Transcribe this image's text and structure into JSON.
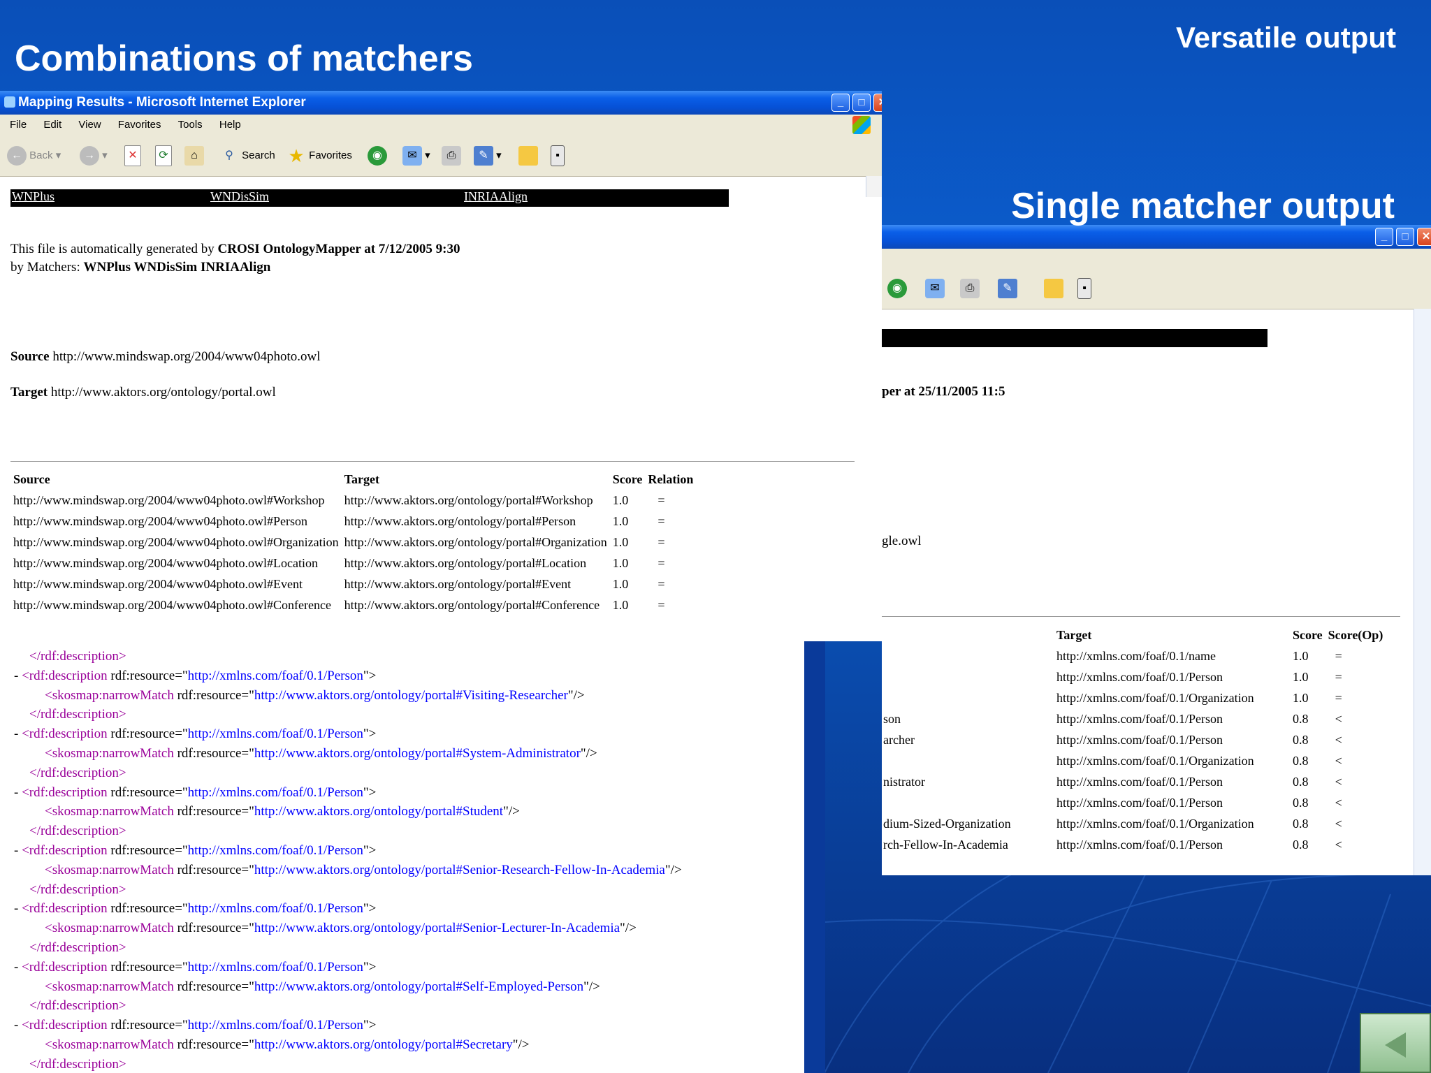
{
  "slide": {
    "title_left": "Combinations of matchers",
    "title_right": "Versatile output",
    "title_single": "Single matcher output"
  },
  "ie_window": {
    "title": "Mapping Results - Microsoft Internet Explorer",
    "menu": [
      "File",
      "Edit",
      "View",
      "Favorites",
      "Tools",
      "Help"
    ],
    "toolbar": {
      "back": "Back",
      "search": "Search",
      "favorites": "Favorites"
    },
    "nav_links": [
      "WNPlus",
      "WNDisSim",
      "INRIAAlign"
    ],
    "generated_prefix": "This file is automatically generated by ",
    "generated_bold": "CROSI OntologyMapper at 7/12/2005 9:30",
    "matchers_prefix": "by Matchers: ",
    "matchers_bold": "WNPlus WNDisSim INRIAAlign",
    "source_label": "Source",
    "source_url": "http://www.mindswap.org/2004/www04photo.owl",
    "target_label": "Target",
    "target_url": "http://www.aktors.org/ontology/portal.owl",
    "table": {
      "headers": [
        "Source",
        "Target",
        "Score",
        "Relation"
      ],
      "rows": [
        [
          "http://www.mindswap.org/2004/www04photo.owl#Workshop",
          "http://www.aktors.org/ontology/portal#Workshop",
          "1.0",
          "="
        ],
        [
          "http://www.mindswap.org/2004/www04photo.owl#Person",
          "http://www.aktors.org/ontology/portal#Person",
          "1.0",
          "="
        ],
        [
          "http://www.mindswap.org/2004/www04photo.owl#Organization",
          "http://www.aktors.org/ontology/portal#Organization",
          "1.0",
          "="
        ],
        [
          "http://www.mindswap.org/2004/www04photo.owl#Location",
          "http://www.aktors.org/ontology/portal#Location",
          "1.0",
          "="
        ],
        [
          "http://www.mindswap.org/2004/www04photo.owl#Event",
          "http://www.aktors.org/ontology/portal#Event",
          "1.0",
          "="
        ],
        [
          "http://www.mindswap.org/2004/www04photo.owl#Conference",
          "http://www.aktors.org/ontology/portal#Conference",
          "1.0",
          "="
        ]
      ]
    }
  },
  "single_window": {
    "generated_fragment": "per at 25/11/2005 11:5",
    "owl_fragment": "gle.owl",
    "table": {
      "headers": [
        "Target",
        "Score",
        "Score(Op)"
      ],
      "rows": [
        [
          "",
          "http://xmlns.com/foaf/0.1/name",
          "1.0",
          "="
        ],
        [
          "",
          "http://xmlns.com/foaf/0.1/Person",
          "1.0",
          "="
        ],
        [
          "",
          "http://xmlns.com/foaf/0.1/Organization",
          "1.0",
          "="
        ],
        [
          "son",
          "http://xmlns.com/foaf/0.1/Person",
          "0.8",
          "<"
        ],
        [
          "archer",
          "http://xmlns.com/foaf/0.1/Person",
          "0.8",
          "<"
        ],
        [
          "",
          "http://xmlns.com/foaf/0.1/Organization",
          "0.8",
          "<"
        ],
        [
          "nistrator",
          "http://xmlns.com/foaf/0.1/Person",
          "0.8",
          "<"
        ],
        [
          "",
          "http://xmlns.com/foaf/0.1/Person",
          "0.8",
          "<"
        ],
        [
          "dium-Sized-Organization",
          "http://xmlns.com/foaf/0.1/Organization",
          "0.8",
          "<"
        ],
        [
          "rch-Fellow-In-Academia",
          "http://xmlns.com/foaf/0.1/Person",
          "0.8",
          "<"
        ]
      ]
    }
  },
  "xml_view": {
    "close_tag": "</rdf:description>",
    "dash": "-",
    "desc_open": "<rdf:description",
    "attr_name": "rdf:resource",
    "person_value": "http://xmlns.com/foaf/0.1/Person",
    "narrow_open": "<skosmap:narrowMatch",
    "narrow_values": [
      "http://www.aktors.org/ontology/portal#Visiting-Researcher",
      "http://www.aktors.org/ontology/portal#System-Administrator",
      "http://www.aktors.org/ontology/portal#Student",
      "http://www.aktors.org/ontology/portal#Senior-Research-Fellow-In-Academia",
      "http://www.aktors.org/ontology/portal#Senior-Lecturer-In-Academia",
      "http://www.aktors.org/ontology/portal#Self-Employed-Person",
      "http://www.aktors.org/ontology/portal#Secretary"
    ]
  },
  "colors": {
    "background": "#0a4fb8",
    "xml_tag": "#990099",
    "xml_value": "#0000ff",
    "titlebar": "#0651d6"
  }
}
